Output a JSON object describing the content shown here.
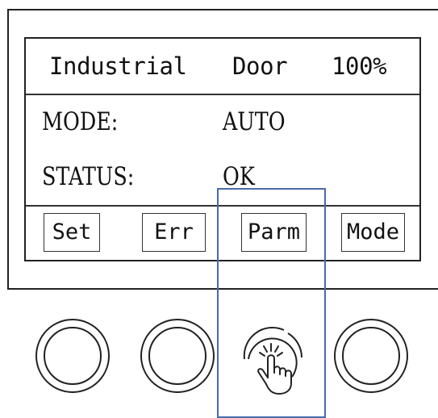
{
  "display": {
    "title": {
      "app": "Industrial",
      "word": "Door",
      "percent": "100%"
    },
    "rows": [
      {
        "label": "MODE:",
        "value": "AUTO"
      },
      {
        "label": "STATUS:",
        "value": "OK"
      }
    ],
    "softkeys": [
      {
        "label": "Set"
      },
      {
        "label": "Err"
      },
      {
        "label": "Parm"
      },
      {
        "label": "Mode"
      }
    ]
  },
  "buttons": [
    {
      "icon": "circle-button-icon"
    },
    {
      "icon": "circle-button-icon"
    },
    {
      "icon": "press-hand-icon"
    },
    {
      "icon": "circle-button-icon"
    }
  ],
  "colors": {
    "outline": "#222222",
    "highlight": "#4a6aa8",
    "background": "#ffffff"
  }
}
